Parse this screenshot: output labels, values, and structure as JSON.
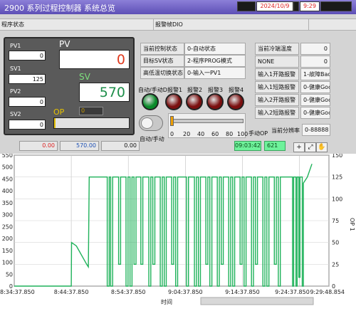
{
  "header": {
    "title": "2900 系列过程控制器   系统总览",
    "date": "2024/10/9",
    "time": "9:29"
  },
  "band": {
    "left_label": "程序状态",
    "right_label": "报警帧DIO"
  },
  "controller": {
    "pv1_label": "PV1",
    "pv1_value": "0",
    "sv1_label": "SV1",
    "sv1_value": "125",
    "pv2_label": "PV2",
    "pv2_value": "0",
    "sv2_label": "SV2",
    "sv2_value": "0",
    "pv_label": "PV",
    "pv_value": "0",
    "sv_label": "SV",
    "sv_value": "570",
    "op_label": "OP",
    "op_value": "0"
  },
  "status_table": [
    {
      "label": "当前控制状态",
      "value": "0-自动状态"
    },
    {
      "label": "目标SV状态",
      "value": "2-程序PROG模式"
    },
    {
      "label": "高低温切换状态",
      "value": "0-输入一PV1"
    }
  ],
  "alarm_table": [
    {
      "label": "当前冷端温度",
      "value": "0"
    },
    {
      "label": "NONE",
      "value": "0"
    },
    {
      "label": "输入1开路报警",
      "value": "1-故障Bad"
    },
    {
      "label": "输入1短路报警",
      "value": "0-健康Good"
    },
    {
      "label": "输入2开路报警",
      "value": "0-健康Good"
    },
    {
      "label": "输入2短路报警",
      "value": "0-健康Good"
    }
  ],
  "resolution": {
    "label": "当前分辨率",
    "value": "0-88888"
  },
  "indicators": {
    "labels": [
      "自动/手动D",
      "报警1",
      "报警2",
      "报警3",
      "报警4"
    ],
    "colors": [
      "#0a8a2a",
      "#7a0f0f",
      "#7a0f0f",
      "#7a0f0f",
      "#7a0f0f"
    ]
  },
  "toggle": {
    "label": "自动/手动"
  },
  "slider": {
    "ticks": [
      "0",
      "20",
      "40",
      "60",
      "80",
      "100"
    ],
    "value": 0
  },
  "manual_op": {
    "label": "手动OP"
  },
  "readouts": {
    "v1": "0.00",
    "v2": "570.00",
    "v3": "0.00",
    "clock": "09:03:42",
    "count": "621"
  },
  "toolbar": {
    "crosshair": "+",
    "zoom": "⤢",
    "pan": "✋"
  },
  "chart_data": {
    "type": "line",
    "xlabel": "时间",
    "y2label": "OP 1",
    "x_ticks": [
      "8:34:37.850",
      "8:44:37.850",
      "8:54:37.850",
      "9:04:37.850",
      "9:14:37.850",
      "9:24:37.850",
      "9:29:48.854"
    ],
    "y_ticks_left": [
      "550",
      "500",
      "450",
      "400",
      "350",
      "300",
      "250",
      "200",
      "150",
      "100",
      "50",
      "0"
    ],
    "y_ticks_right": [
      "150",
      "125",
      "100",
      "75",
      "50",
      "25",
      "0"
    ],
    "ylim_right": [
      0,
      150
    ],
    "series_color": "#1fb25a",
    "series": [
      {
        "name": "OP 1",
        "x_minutes": [
          10.0,
          10.1,
          10.9,
          12.7,
          13.0,
          13.2,
          14.5,
          47.5,
          48.8,
          49.0,
          49.4,
          49.8,
          50.2,
          50.8,
          51.4
        ],
        "values": [
          0,
          50,
          45,
          25,
          22,
          125,
          125,
          125,
          0,
          125,
          0,
          125,
          0,
          125,
          140
        ]
      }
    ]
  }
}
